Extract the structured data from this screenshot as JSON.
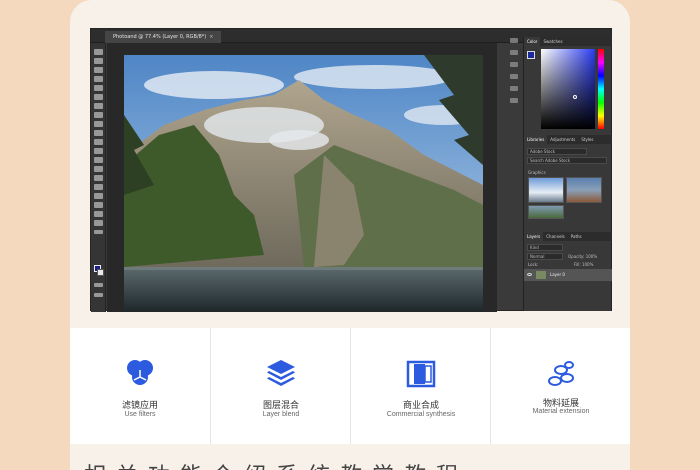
{
  "document_tab": {
    "title": "Photoand @ 77.4% (Layer 0, RGB/8*)",
    "close": "×"
  },
  "colors": {
    "page_bg": "#f5d9bf",
    "accent_blue": "#2c5be0",
    "photoshop_dark": "#3a3a3a"
  },
  "panels": {
    "color_tabs": [
      "Color",
      "Swatches"
    ],
    "library_tabs": [
      "Libraries",
      "Adjustments",
      "Styles"
    ],
    "library_select": "Adobe Stock",
    "library_search_placeholder": "Search Adobe Stock",
    "graphics_label": "Graphics",
    "layers_tabs": [
      "Layers",
      "Channels",
      "Paths"
    ],
    "layers_filter": "Kind",
    "blend_mode": "Normal",
    "opacity_label": "Opacity: 100%",
    "lock_label": "Lock:",
    "fill_label": "Fill: 100%",
    "layer_name": "Layer 0"
  },
  "features": [
    {
      "icon": "filter-circles-icon",
      "cn": "滤镜应用",
      "en": "Use filters"
    },
    {
      "icon": "layers-stack-icon",
      "cn": "图层混合",
      "en": "Layer blend"
    },
    {
      "icon": "composite-frames-icon",
      "cn": "商业合成",
      "en": "Commercial synthesis"
    },
    {
      "icon": "material-stack-icon",
      "cn": "物料延展",
      "en": "Material extension"
    }
  ],
  "bottom_heading": "相关功能介绍系统教学教程"
}
